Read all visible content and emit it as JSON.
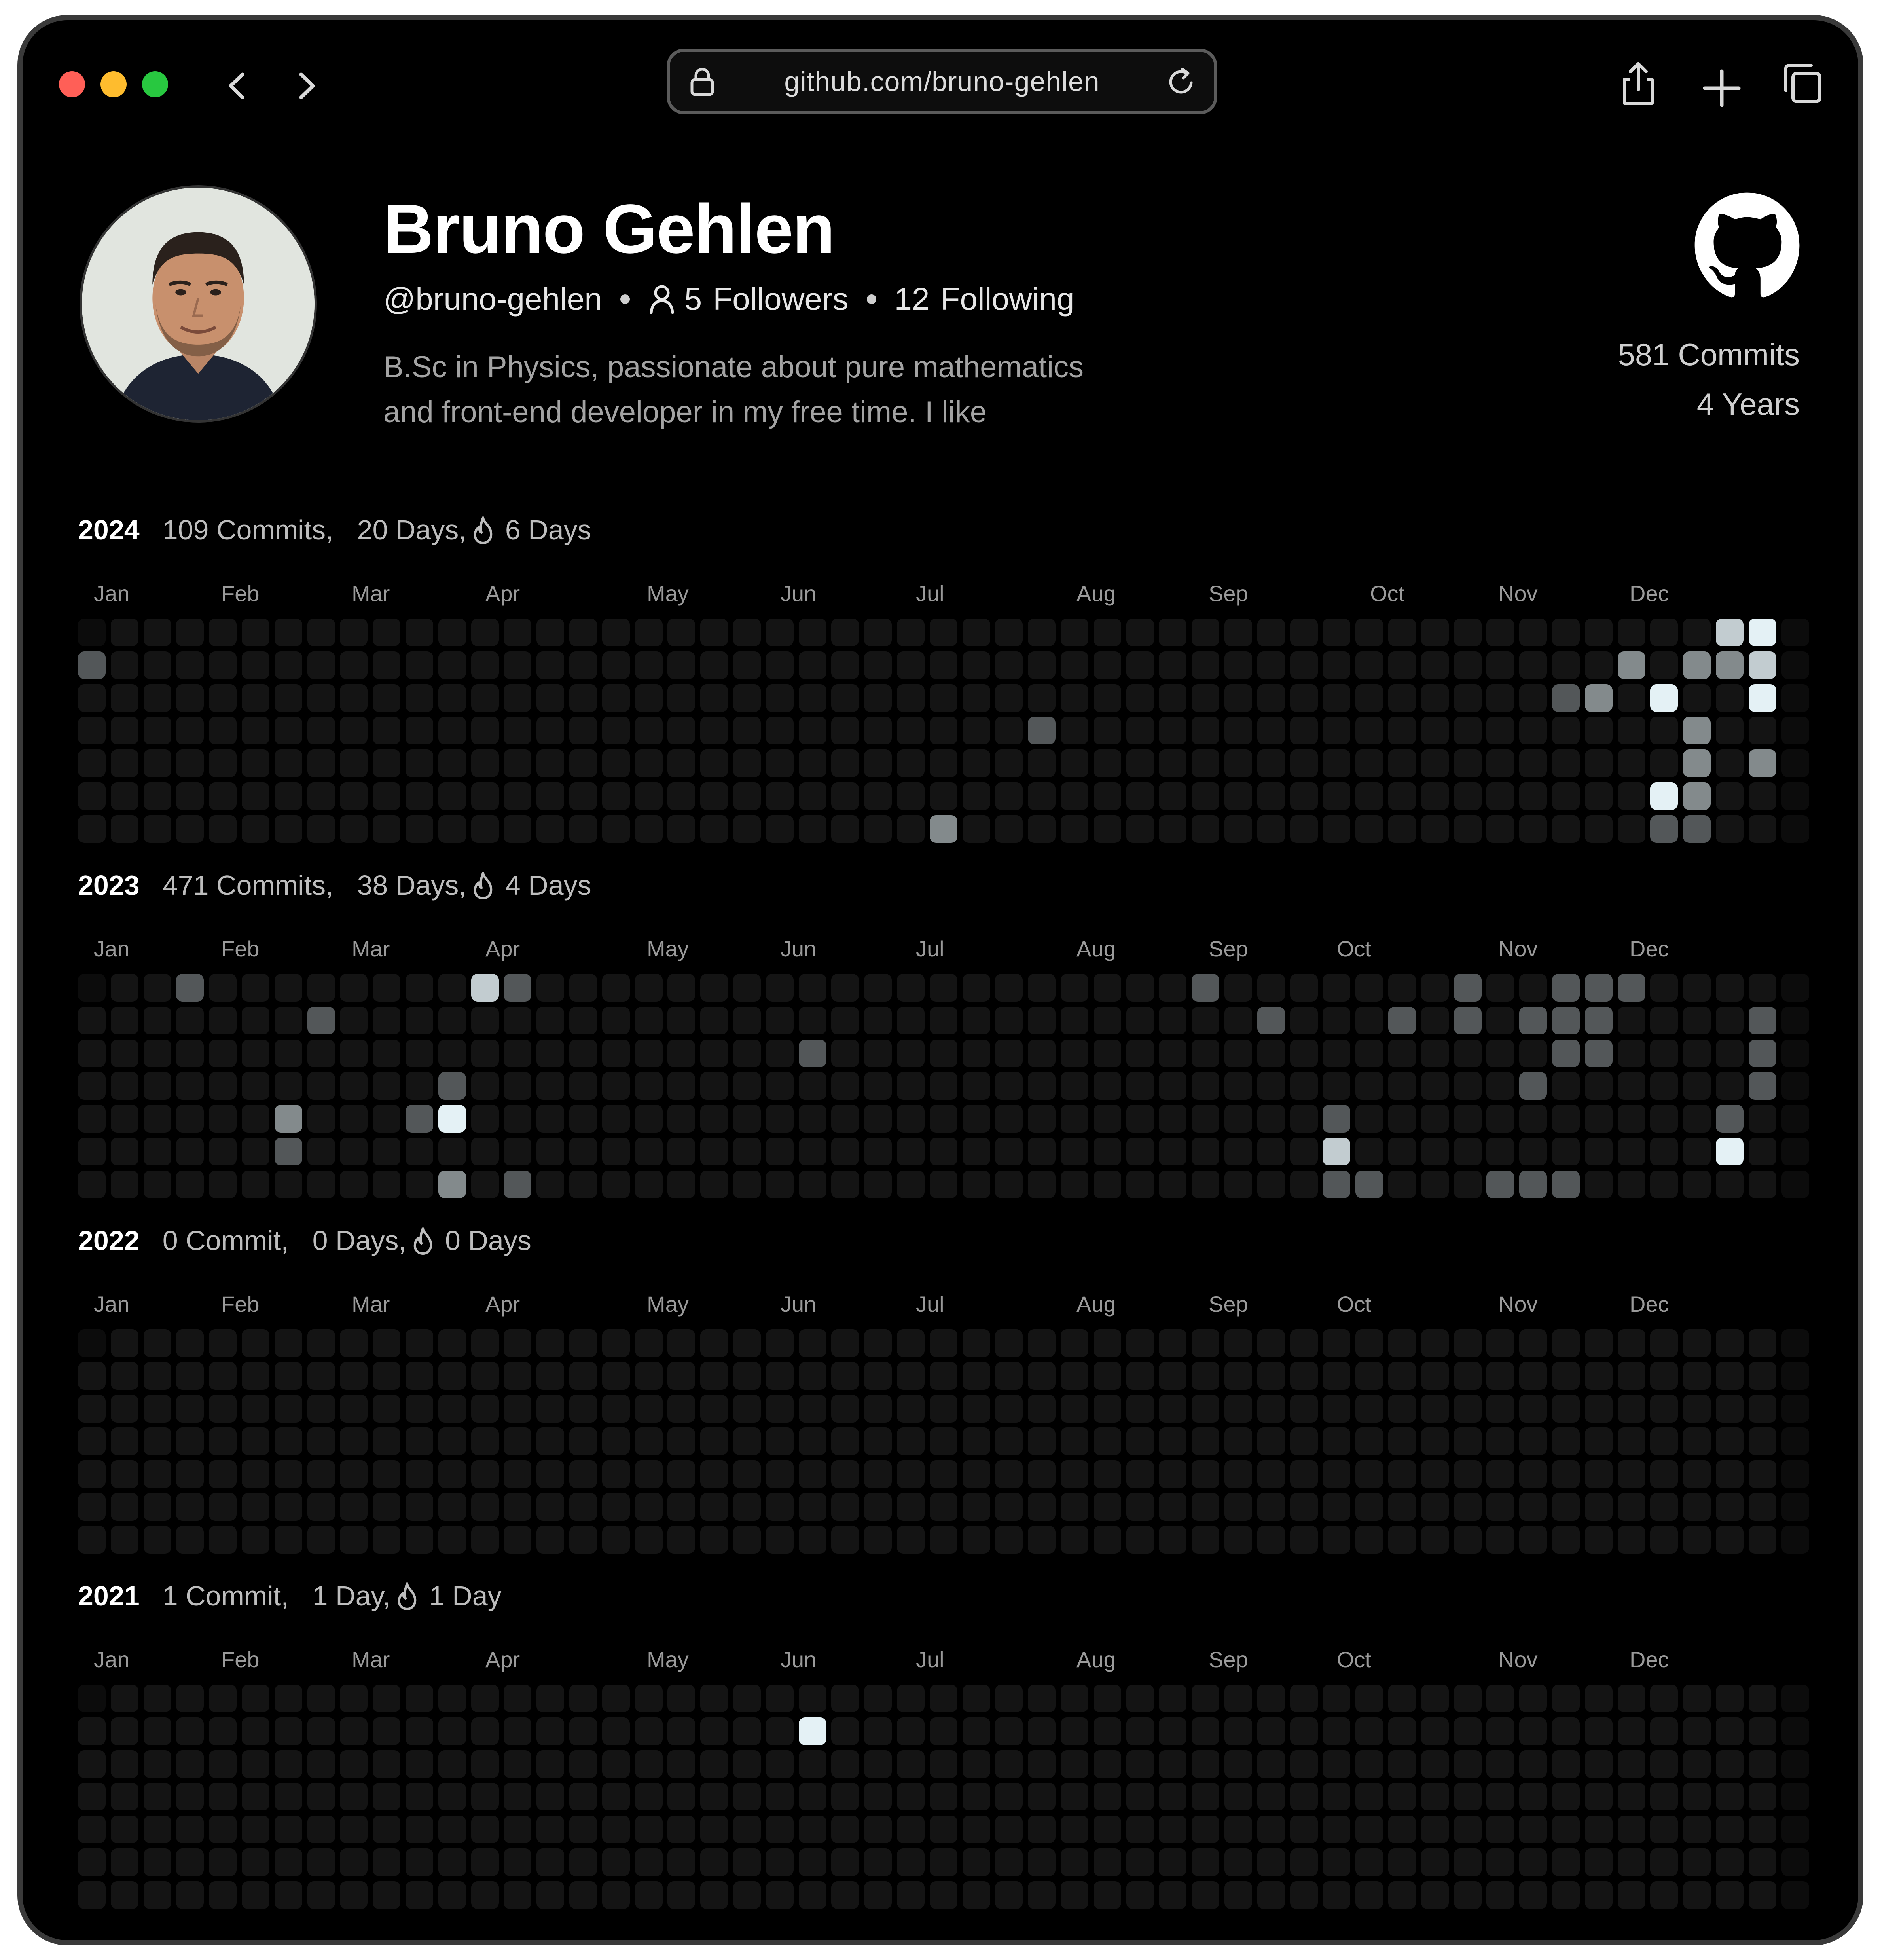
{
  "browser": {
    "url": "github.com/bruno-gehlen",
    "icons": [
      "back-chevron-icon",
      "forward-chevron-icon",
      "lock-icon",
      "reload-icon",
      "share-icon",
      "new-tab-plus-icon",
      "tabs-icon"
    ]
  },
  "profile": {
    "name": "Bruno Gehlen",
    "handle": "@bruno-gehlen",
    "followers_count": "5",
    "followers_label": "Followers",
    "following_count": "12",
    "following_label": "Following",
    "bio_line1": "B.Sc in Physics, passionate about pure mathematics",
    "bio_line2": "and front-end developer in my free time. I like",
    "total_commits": "581 Commits",
    "total_years": "4 Years"
  },
  "colors": {
    "background": "#000000",
    "level0": "#141414",
    "level1": "#535759",
    "level2": "#838a8c",
    "level3": "#c2ccd0",
    "level4": "#e4f1f5"
  },
  "years": [
    {
      "year": "2024",
      "commits": "109 Commits,",
      "days": "20 Days,",
      "streak": "6 Days",
      "months": [
        "Jan",
        "Feb",
        "Mar",
        "Apr",
        "May",
        "Jun",
        "Jul",
        "Aug",
        "Sep",
        "Oct",
        "Nov",
        "Dec"
      ],
      "activity": [
        [
          0,
          1,
          1
        ],
        [
          26,
          6,
          2
        ],
        [
          29,
          3,
          1
        ],
        [
          45,
          2,
          1
        ],
        [
          46,
          2,
          2
        ],
        [
          47,
          1,
          2
        ],
        [
          48,
          2,
          4
        ],
        [
          48,
          5,
          4
        ],
        [
          48,
          6,
          1
        ],
        [
          49,
          1,
          2
        ],
        [
          49,
          3,
          2
        ],
        [
          49,
          4,
          2
        ],
        [
          49,
          5,
          2
        ],
        [
          49,
          6,
          1
        ],
        [
          50,
          0,
          3
        ],
        [
          50,
          1,
          2
        ],
        [
          51,
          0,
          4
        ],
        [
          51,
          1,
          3
        ],
        [
          51,
          2,
          4
        ],
        [
          51,
          4,
          2
        ]
      ]
    },
    {
      "year": "2023",
      "commits": "471 Commits,",
      "days": "38 Days,",
      "streak": "4 Days",
      "months": [
        "Jan",
        "Feb",
        "Mar",
        "Apr",
        "May",
        "Jun",
        "Jul",
        "Aug",
        "Sep",
        "Oct",
        "Nov",
        "Dec"
      ],
      "activity": [
        [
          3,
          0,
          1
        ],
        [
          6,
          4,
          2
        ],
        [
          6,
          5,
          1
        ],
        [
          7,
          1,
          1
        ],
        [
          10,
          4,
          1
        ],
        [
          11,
          3,
          1
        ],
        [
          11,
          4,
          4
        ],
        [
          11,
          6,
          2
        ],
        [
          12,
          0,
          3
        ],
        [
          13,
          0,
          1
        ],
        [
          13,
          6,
          1
        ],
        [
          22,
          2,
          1
        ],
        [
          34,
          0,
          1
        ],
        [
          36,
          1,
          1
        ],
        [
          38,
          4,
          1
        ],
        [
          38,
          5,
          3
        ],
        [
          38,
          6,
          1
        ],
        [
          39,
          6,
          1
        ],
        [
          40,
          1,
          1
        ],
        [
          42,
          0,
          1
        ],
        [
          42,
          1,
          1
        ],
        [
          43,
          6,
          1
        ],
        [
          44,
          1,
          1
        ],
        [
          44,
          3,
          1
        ],
        [
          44,
          6,
          1
        ],
        [
          45,
          0,
          1
        ],
        [
          45,
          1,
          1
        ],
        [
          45,
          2,
          1
        ],
        [
          45,
          6,
          1
        ],
        [
          46,
          0,
          1
        ],
        [
          46,
          1,
          1
        ],
        [
          46,
          2,
          1
        ],
        [
          47,
          0,
          1
        ],
        [
          50,
          4,
          1
        ],
        [
          50,
          5,
          4
        ],
        [
          51,
          1,
          1
        ],
        [
          51,
          2,
          1
        ],
        [
          51,
          3,
          1
        ]
      ]
    },
    {
      "year": "2022",
      "commits": "0 Commit,",
      "days": "0 Days,",
      "streak": "0 Days",
      "months": [
        "Jan",
        "Feb",
        "Mar",
        "Apr",
        "May",
        "Jun",
        "Jul",
        "Aug",
        "Sep",
        "Oct",
        "Nov",
        "Dec"
      ],
      "activity": []
    },
    {
      "year": "2021",
      "commits": "1 Commit,",
      "days": "1 Day,",
      "streak": "1 Day",
      "months": [
        "Jan",
        "Feb",
        "Mar",
        "Apr",
        "May",
        "Jun",
        "Jul",
        "Aug",
        "Sep",
        "Oct",
        "Nov",
        "Dec"
      ],
      "activity": [
        [
          22,
          1,
          4
        ]
      ]
    }
  ]
}
